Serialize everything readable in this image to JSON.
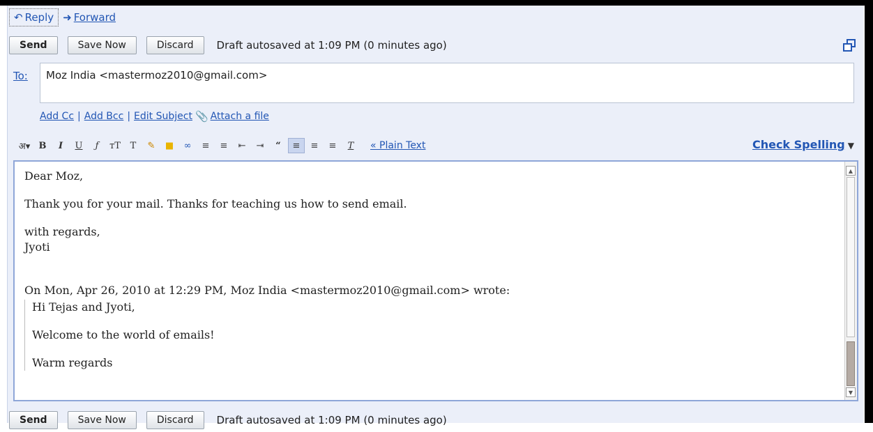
{
  "reply_forward": {
    "reply_label": "Reply",
    "forward_label": "Forward"
  },
  "toolbar_top": {
    "send_label": "Send",
    "save_label": "Save Now",
    "discard_label": "Discard",
    "autosave_text": "Draft autosaved at 1:09 PM (0 minutes ago)"
  },
  "to_field": {
    "label": "To:",
    "value": "Moz India <mastermoz2010@gmail.com>"
  },
  "address_links": {
    "add_cc": "Add Cc",
    "add_bcc": "Add Bcc",
    "edit_subject": "Edit Subject",
    "attach": "Attach a file"
  },
  "formatting": {
    "plain_text_link": "« Plain Text",
    "check_spelling": "Check Spelling"
  },
  "message": {
    "greeting": "Dear Moz,",
    "line1": "Thank you for your mail. Thanks for teaching us how to send email.",
    "closing": "with regards,",
    "signature": "Jyoti",
    "quote_header": "On Mon, Apr 26, 2010 at 12:29 PM, Moz India <mastermoz2010@gmail.com> wrote:",
    "quoted": {
      "greeting": "Hi Tejas and Jyoti,",
      "line1": "Welcome to the world of emails!",
      "closing": "Warm regards"
    }
  },
  "toolbar_bottom": {
    "send_label": "Send",
    "save_label": "Save Now",
    "discard_label": "Discard",
    "autosave_text": "Draft autosaved at 1:09 PM (0 minutes ago)"
  },
  "colors": {
    "link": "#2256b4",
    "panel_bg": "#ebeff9",
    "editor_border": "#8ea6d8"
  }
}
